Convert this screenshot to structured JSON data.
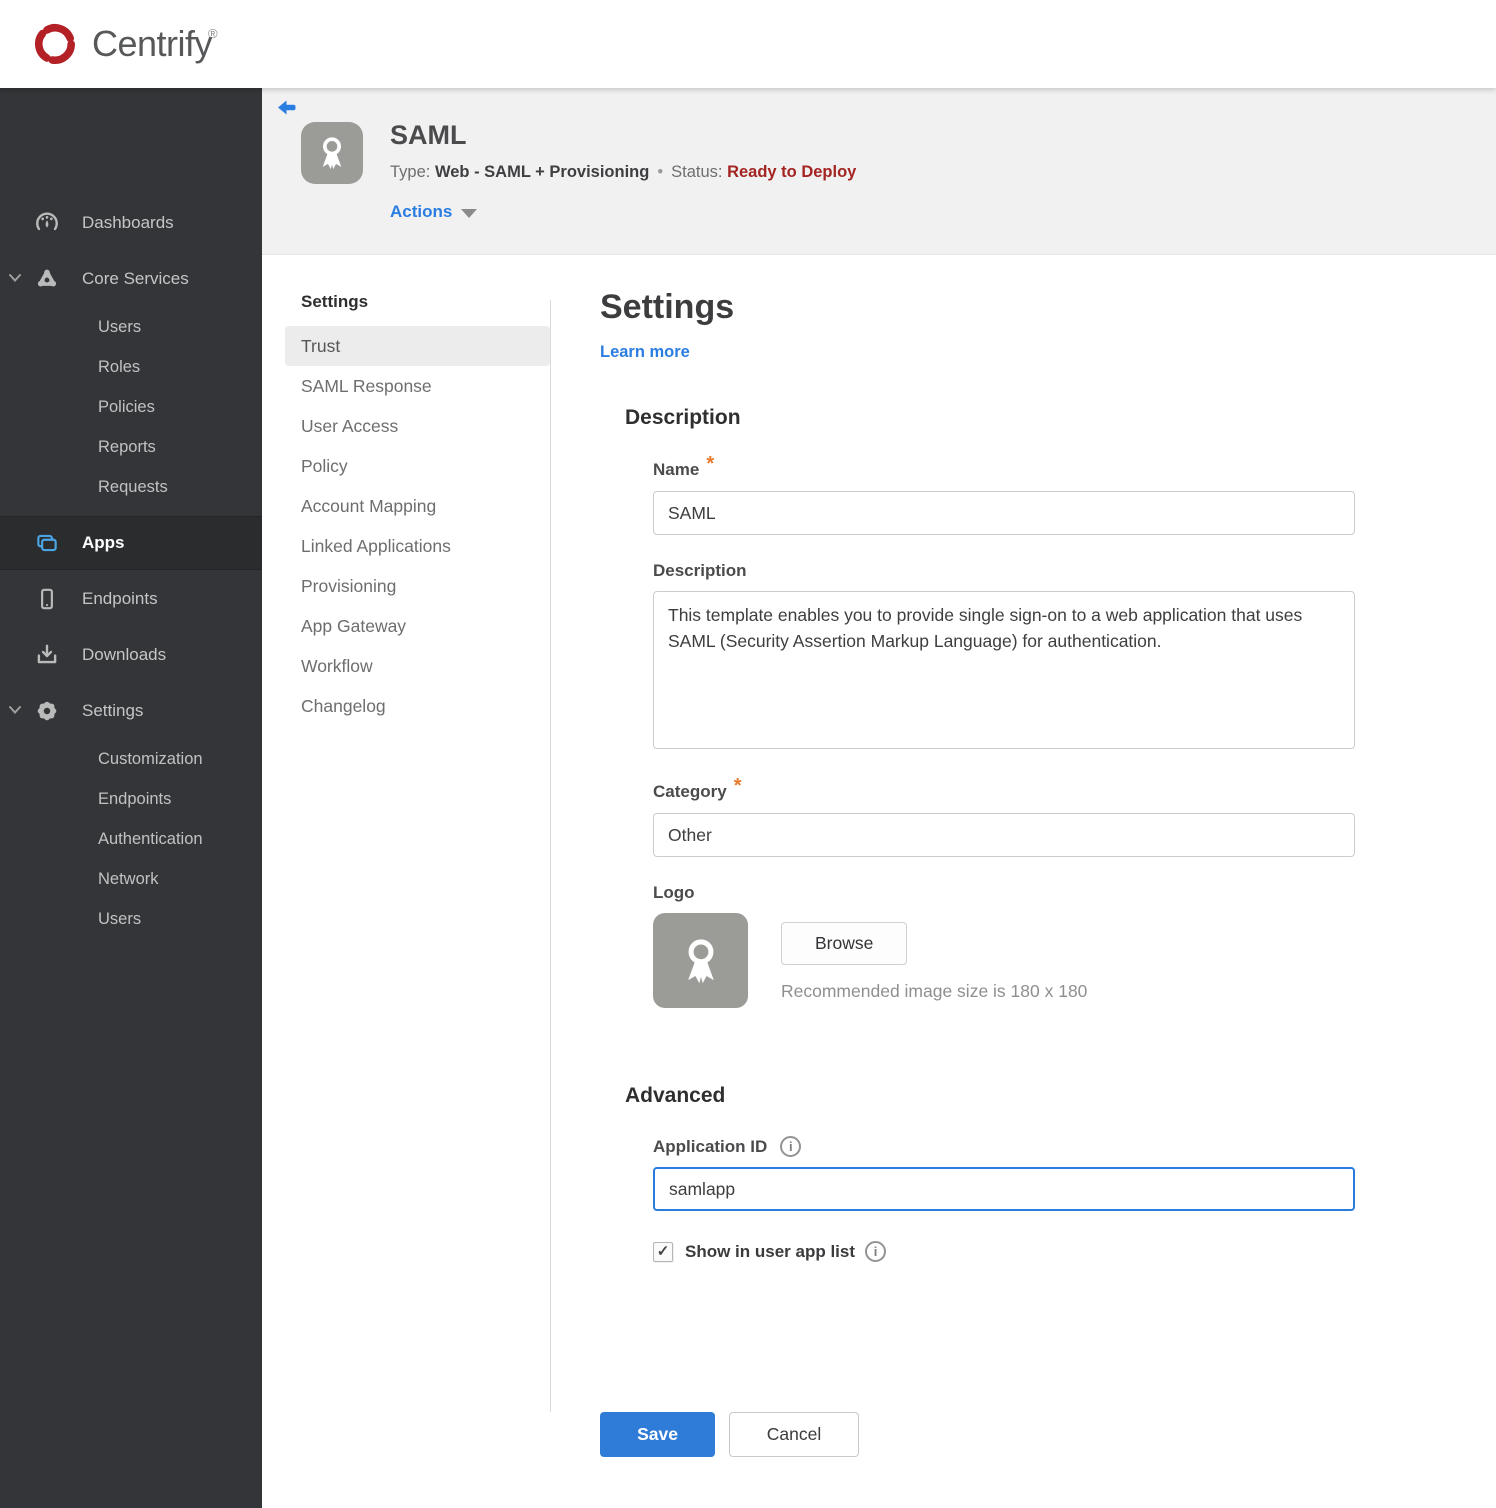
{
  "brand": {
    "name": "Centrify",
    "registered": "®"
  },
  "sidebar": {
    "items": [
      {
        "label": "Dashboards",
        "icon": "gauge-icon"
      },
      {
        "label": "Core Services",
        "icon": "core-services-icon",
        "expanded": true,
        "children": [
          {
            "label": "Users"
          },
          {
            "label": "Roles"
          },
          {
            "label": "Policies"
          },
          {
            "label": "Reports"
          },
          {
            "label": "Requests"
          }
        ]
      },
      {
        "label": "Apps",
        "icon": "apps-icon",
        "active": true
      },
      {
        "label": "Endpoints",
        "icon": "endpoint-icon"
      },
      {
        "label": "Downloads",
        "icon": "download-icon"
      },
      {
        "label": "Settings",
        "icon": "gear-icon",
        "expanded": true,
        "children": [
          {
            "label": "Customization"
          },
          {
            "label": "Endpoints"
          },
          {
            "label": "Authentication"
          },
          {
            "label": "Network"
          },
          {
            "label": "Users"
          }
        ]
      }
    ]
  },
  "app_header": {
    "title": "SAML",
    "type_label": "Type:",
    "type_value": "Web - SAML + Provisioning",
    "separator": "•",
    "status_label": "Status:",
    "status_value": "Ready to Deploy",
    "actions_label": "Actions"
  },
  "subnav": {
    "header": "Settings",
    "selected": "Trust",
    "items": [
      "Trust",
      "SAML Response",
      "User Access",
      "Policy",
      "Account Mapping",
      "Linked Applications",
      "Provisioning",
      "App Gateway",
      "Workflow",
      "Changelog"
    ]
  },
  "main": {
    "title": "Settings",
    "learn_more": "Learn more",
    "required_marker": "*",
    "description_section": {
      "heading": "Description",
      "name_label": "Name",
      "name_value": "SAML",
      "description_label": "Description",
      "description_value": "This template enables you to provide single sign-on to a web application that uses SAML (Security Assertion Markup Language) for authentication.",
      "category_label": "Category",
      "category_value": "Other",
      "logo_label": "Logo",
      "browse_label": "Browse",
      "logo_hint": "Recommended image size is 180 x 180"
    },
    "advanced_section": {
      "heading": "Advanced",
      "app_id_label": "Application ID",
      "app_id_value": "samlapp",
      "show_in_list_label": "Show in user app list",
      "checkbox_checked": true,
      "check_glyph": "✓",
      "info_glyph": "i"
    },
    "save_label": "Save",
    "cancel_label": "Cancel"
  },
  "colors": {
    "brand_red": "#b32025",
    "accent_blue": "#2a7de1",
    "status_red": "#a32420",
    "save_blue": "#2e7cd7",
    "sidebar_bg": "#333538",
    "apps_icon_blue": "#4aa4e4"
  }
}
